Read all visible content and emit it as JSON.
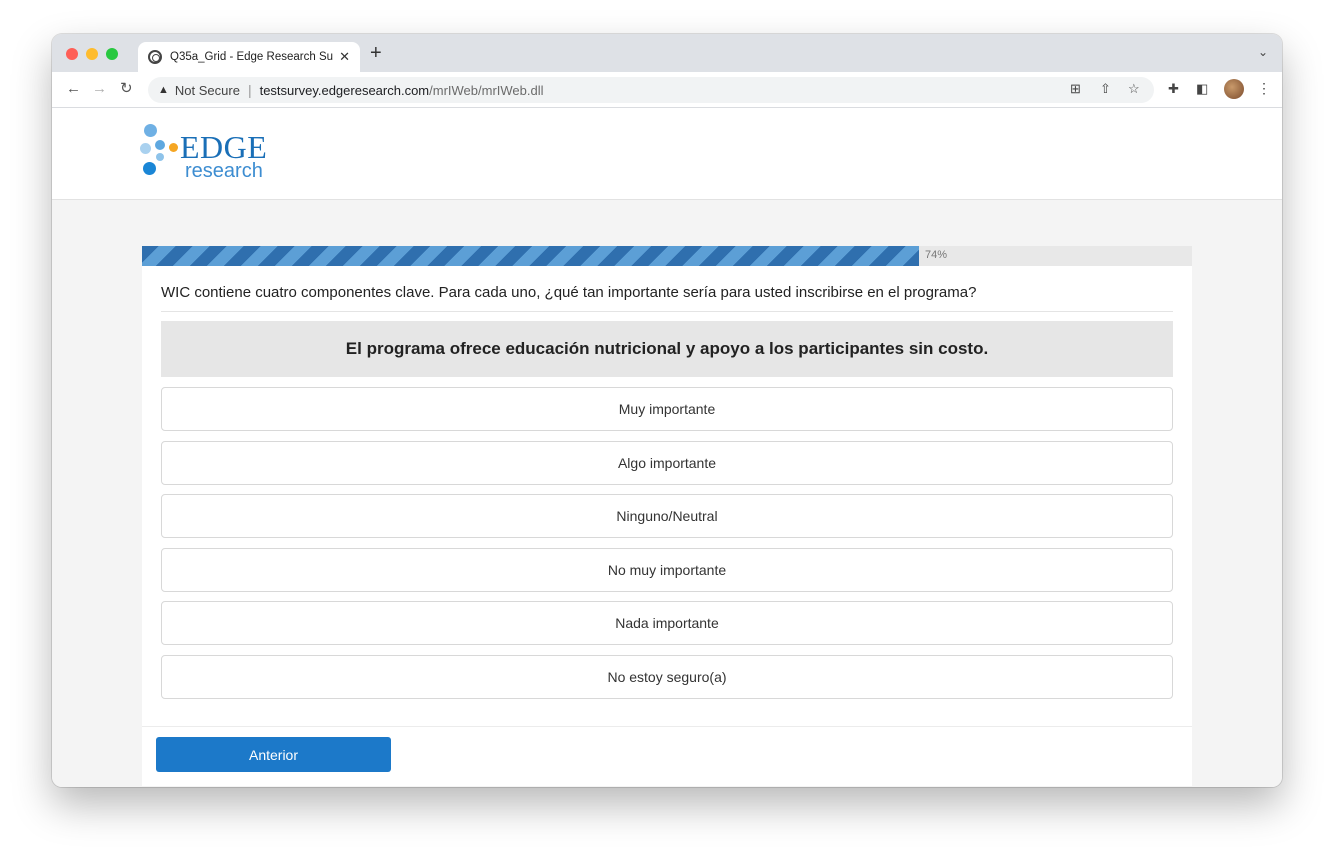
{
  "browser": {
    "tab_title": "Q35a_Grid - Edge Research Su",
    "tab_close": "✕",
    "new_tab": "+",
    "security_label": "Not Secure",
    "url_host": "testsurvey.edgeresearch.com",
    "url_path": "/mrIWeb/mrIWeb.dll"
  },
  "logo": {
    "name": "EDGE",
    "sub": "research",
    "colors": {
      "blue": "#1a6fb7",
      "light_blue": "#a9d1ef",
      "orange": "#f5a623"
    }
  },
  "progress": {
    "percent": 74,
    "label": "74%",
    "color": "#2f6fae"
  },
  "survey": {
    "question": "WIC contiene cuatro componentes clave. Para cada uno, ¿qué tan importante sería para usted inscribirse en el programa?",
    "statement": "El programa ofrece educación nutricional y apoyo a los participantes sin costo.",
    "options": [
      "Muy importante",
      "Algo importante",
      "Ninguno/Neutral",
      "No muy importante",
      "Nada importante",
      "No estoy seguro(a)"
    ],
    "prev_button": "Anterior"
  },
  "accent_color": "#1c79c9"
}
